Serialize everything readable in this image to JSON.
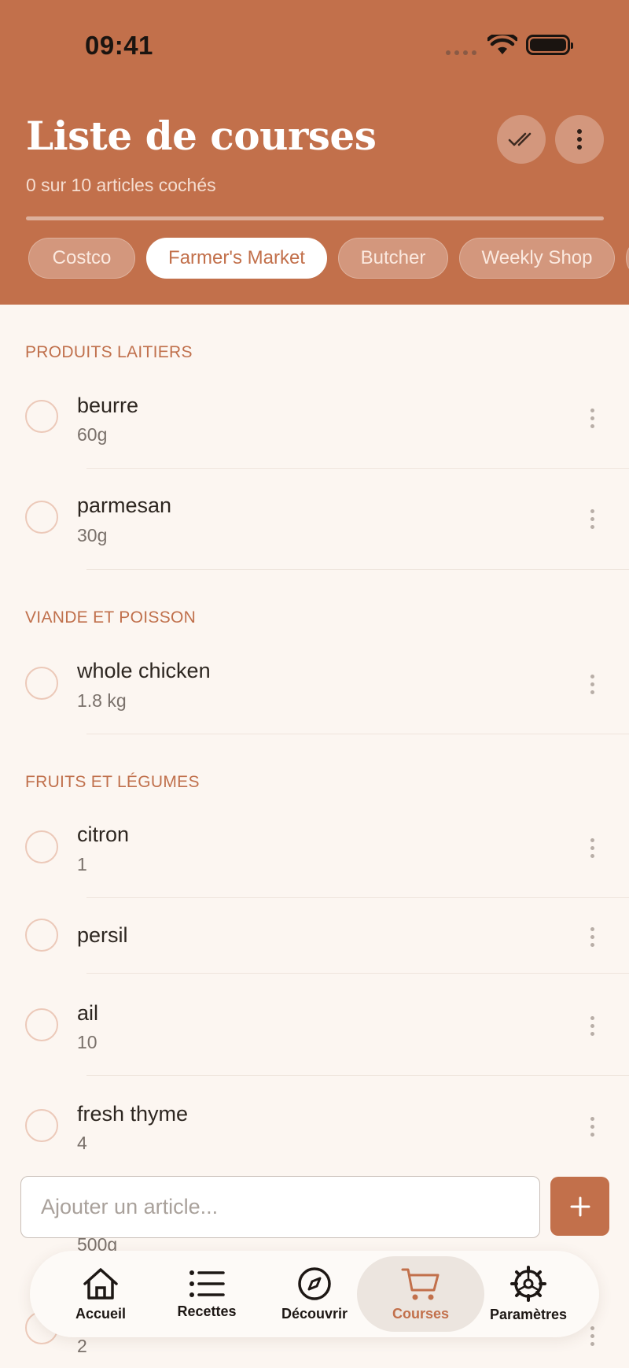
{
  "status_bar": {
    "time": "09:41"
  },
  "header": {
    "title": "Liste de courses",
    "subtitle": "0 sur 10 articles cochés",
    "progress_fraction": 0,
    "check_all_icon": "double-check-icon",
    "more_icon": "more-vertical-icon"
  },
  "stores": [
    {
      "label": "Costco",
      "active": false
    },
    {
      "label": "Farmer's Market",
      "active": true
    },
    {
      "label": "Butcher",
      "active": false
    },
    {
      "label": "Weekly Shop",
      "active": false
    }
  ],
  "sections": [
    {
      "title": "PRODUITS LAITIERS",
      "items": [
        {
          "name": "beurre",
          "qty": "60g"
        },
        {
          "name": "parmesan",
          "qty": "30g"
        }
      ]
    },
    {
      "title": "VIANDE ET POISSON",
      "items": [
        {
          "name": "whole chicken",
          "qty": "1.8 kg"
        }
      ]
    },
    {
      "title": "FRUITS ET LÉGUMES",
      "items": [
        {
          "name": "citron",
          "qty": "1"
        },
        {
          "name": "persil",
          "qty": ""
        },
        {
          "name": "ail",
          "qty": "10"
        },
        {
          "name": "fresh thyme",
          "qty": "4"
        }
      ]
    }
  ],
  "partially_hidden": {
    "qty_1": "500g",
    "qty_2": "2"
  },
  "add_item": {
    "placeholder": "Ajouter un article..."
  },
  "nav": [
    {
      "label": "Accueil",
      "icon": "home-icon"
    },
    {
      "label": "Recettes",
      "icon": "list-icon"
    },
    {
      "label": "Découvrir",
      "icon": "compass-icon"
    },
    {
      "label": "Courses",
      "icon": "cart-icon",
      "active": true
    },
    {
      "label": "Paramètres",
      "icon": "gear-icon"
    }
  ],
  "colors": {
    "accent": "#c2704b",
    "background": "#fcf6f1"
  }
}
